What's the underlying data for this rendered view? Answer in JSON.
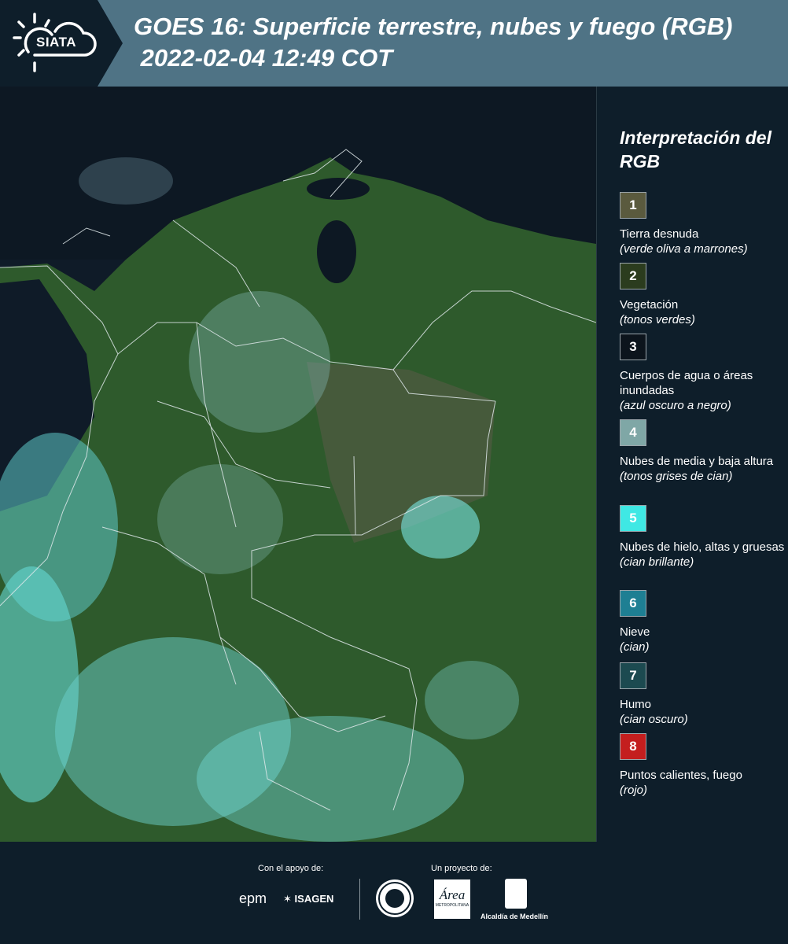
{
  "header": {
    "logo": "SIATA",
    "title_line1": "GOES 16: Superficie terrestre, nubes y fuego (RGB)",
    "title_line2": " 2022-02-04 12:49 COT"
  },
  "legend": {
    "title": "Interpretación del RGB",
    "items": [
      {
        "number": "1",
        "color": "#5a5a3e",
        "label": "Tierra desnuda",
        "desc": "(verde oliva a marrones)"
      },
      {
        "number": "2",
        "color": "#2b3c1e",
        "label": "Vegetación",
        "desc": "(tonos verdes)"
      },
      {
        "number": "3",
        "color": "#0c141c",
        "label": "Cuerpos de agua o áreas inundadas",
        "desc": "(azul oscuro a negro)"
      },
      {
        "number": "4",
        "color": "#7fa7a6",
        "label": "Nubes de media y baja altura",
        "desc": "(tonos grises de cian)"
      },
      {
        "number": "5",
        "color": "#3fe8e4",
        "label": "Nubes de hielo, altas y gruesas",
        "desc": "(cian brillante)"
      },
      {
        "number": "6",
        "color": "#1e7f93",
        "label": "Nieve",
        "desc": "(cian)"
      },
      {
        "number": "7",
        "color": "#1c4a50",
        "label": "Humo",
        "desc": "(cian oscuro)"
      },
      {
        "number": "8",
        "color": "#c41e1e",
        "label": "Puntos calientes, fuego",
        "desc": "(rojo)"
      }
    ]
  },
  "footer": {
    "support_label": "Con el apoyo de:",
    "project_label": "Un proyecto de:",
    "logo_epm": "epm",
    "logo_isagen": "ISAGEN",
    "logo_area": "Área",
    "logo_area_sub": "METROPOLITANA",
    "logo_alcaldia": "Alcaldía de Medellín"
  }
}
